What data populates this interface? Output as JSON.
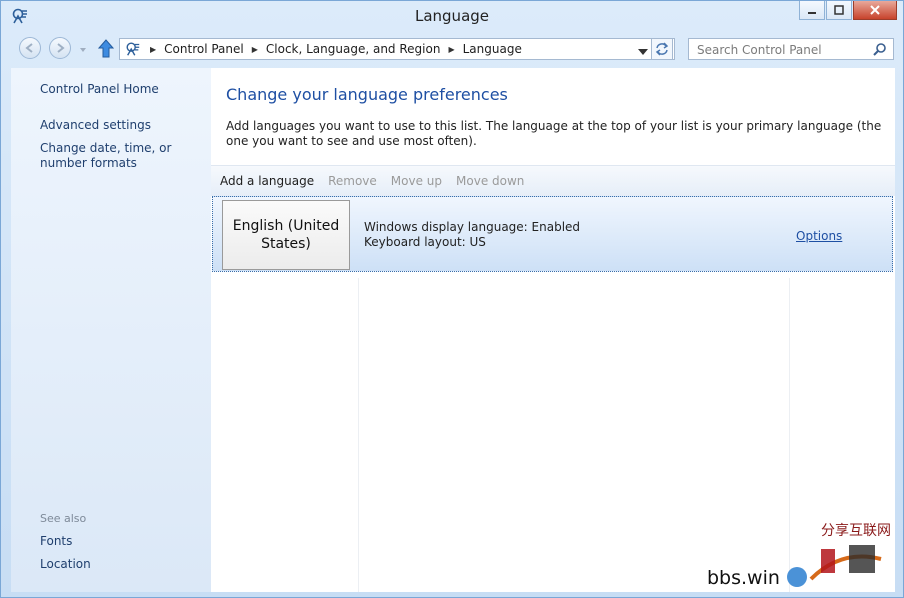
{
  "window": {
    "title": "Language",
    "icon": "control-panel-icon"
  },
  "nav": {
    "breadcrumbs": [
      "Control Panel",
      "Clock, Language, and Region",
      "Language"
    ],
    "search_placeholder": "Search Control Panel"
  },
  "sidebar": {
    "home": "Control Panel Home",
    "advanced": "Advanced settings",
    "date_time": "Change date, time, or number formats",
    "see_also": "See also",
    "fonts": "Fonts",
    "location": "Location"
  },
  "main": {
    "heading": "Change your language preferences",
    "description": "Add languages you want to use to this list. The language at the top of your list is your primary language (the one you want to see and use most often).",
    "toolbar": {
      "add": "Add a language",
      "remove": "Remove",
      "move_up": "Move up",
      "move_down": "Move down"
    },
    "languages": [
      {
        "name": "English (United States)",
        "display_status": "Windows display language: Enabled",
        "keyboard": "Keyboard layout: US",
        "options": "Options"
      }
    ]
  },
  "watermark": {
    "site": "bbs.win",
    "logo_text": "分享互联网"
  },
  "colors": {
    "accent": "#1e4fa3",
    "link": "#1f3f6e",
    "disabled": "#9a9a9a",
    "selection": "#cde0f6"
  }
}
